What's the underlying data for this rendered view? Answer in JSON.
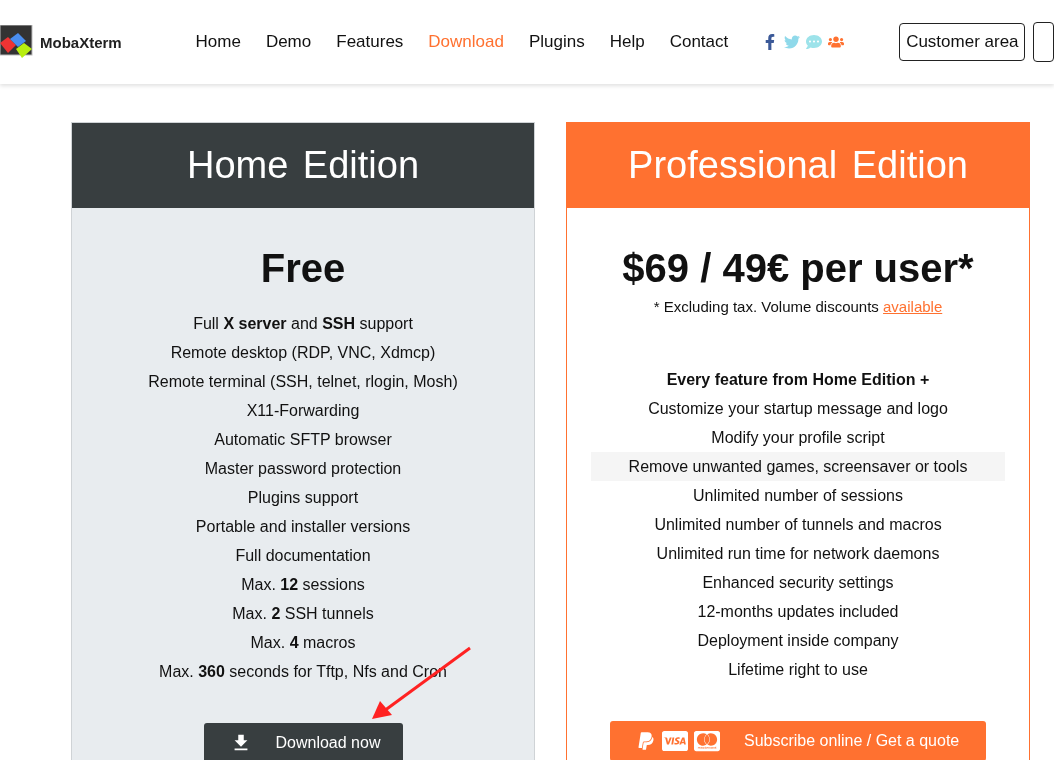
{
  "header": {
    "logo": "MobaXterm",
    "nav": [
      {
        "label": "Home",
        "selected": false
      },
      {
        "label": "Demo",
        "selected": false
      },
      {
        "label": "Features",
        "selected": false
      },
      {
        "label": "Download",
        "selected": true
      },
      {
        "label": "Plugins",
        "selected": false
      },
      {
        "label": "Help",
        "selected": false
      },
      {
        "label": "Contact",
        "selected": false
      }
    ],
    "social": [
      {
        "kind": "facebook",
        "color": "#3b5998"
      },
      {
        "kind": "twitter",
        "color": "#8fd9ea"
      },
      {
        "kind": "chat",
        "color": "#9de3ea"
      },
      {
        "kind": "group",
        "color": "#ff7130"
      }
    ],
    "customer_button": "Customer area"
  },
  "home": {
    "title": "Home Edition",
    "price": "Free",
    "features": [
      "Full **X server** and **SSH** support",
      "Remote desktop (RDP, VNC, Xdmcp)",
      "Remote terminal (SSH, telnet, rlogin, Mosh)",
      "X11-Forwarding",
      "Automatic SFTP browser",
      "Master password protection",
      "Plugins support",
      "Portable and installer versions",
      "Full documentation",
      "Max. **12** sessions",
      "Max. **2** SSH tunnels",
      "Max. **4** macros",
      "Max. **360** seconds for Tftp, Nfs and Cron"
    ],
    "button": "Download now"
  },
  "pro": {
    "title": "Professional Edition",
    "price": "$69 / 49€ per user*",
    "note": "* Excluding tax. Volume discounts",
    "note_link": "available",
    "features": [
      {
        "text": "Every feature from Home Edition +",
        "kind": "heading",
        "highlighted": false
      },
      {
        "text": "Customize your startup message and logo",
        "kind": "item",
        "highlighted": false
      },
      {
        "text": "Modify your profile script",
        "kind": "item",
        "highlighted": false
      },
      {
        "text": "Remove unwanted games, screensaver or tools",
        "kind": "item",
        "highlighted": true
      },
      {
        "text": "Unlimited number of sessions",
        "kind": "item",
        "highlighted": false
      },
      {
        "text": "Unlimited number of tunnels and macros",
        "kind": "item",
        "highlighted": false
      },
      {
        "text": "Unlimited run time for network daemons",
        "kind": "item",
        "highlighted": false
      },
      {
        "text": "Enhanced security settings",
        "kind": "item",
        "highlighted": false
      },
      {
        "text": "12-months updates included",
        "kind": "item",
        "highlighted": false
      },
      {
        "text": "Deployment inside company",
        "kind": "item",
        "highlighted": false
      },
      {
        "text": "Lifetime right to use",
        "kind": "item",
        "highlighted": false
      }
    ],
    "button": "Subscribe online / Get a quote"
  }
}
